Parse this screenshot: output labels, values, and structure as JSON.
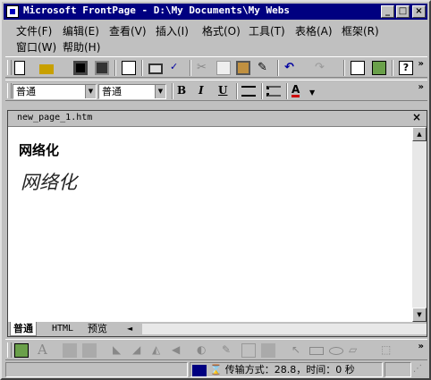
{
  "window": {
    "title": "Microsoft FrontPage - D:\\My Documents\\My Webs",
    "min_glyph": "_",
    "max_glyph": "□",
    "close_glyph": "×"
  },
  "menu": {
    "row1": [
      "文件(F)",
      "编辑(E)",
      "查看(V)",
      "插入(I)",
      "格式(O)",
      "工具(T)",
      "表格(A)",
      "框架(R)"
    ],
    "row2": [
      "窗口(W)",
      "帮助(H)"
    ]
  },
  "format_toolbar": {
    "style_value": "普通",
    "font_value": "普通",
    "bold": "B",
    "italic": "I",
    "underline": "U",
    "font_color_glyph": "A"
  },
  "toolbar": {
    "chevron": "»"
  },
  "document": {
    "filename": "new_page_1.htm",
    "close_glyph": "×",
    "heading": "网络化",
    "italic_text": "网络化"
  },
  "view_tabs": [
    "普通",
    "HTML",
    "预览"
  ],
  "status": {
    "transfer_text": "传输方式：28.8，时间：0 秒"
  },
  "colors": {
    "title_bar": "#000080",
    "face": "#c0c0c0",
    "font_color_underline": "#cc0000"
  }
}
